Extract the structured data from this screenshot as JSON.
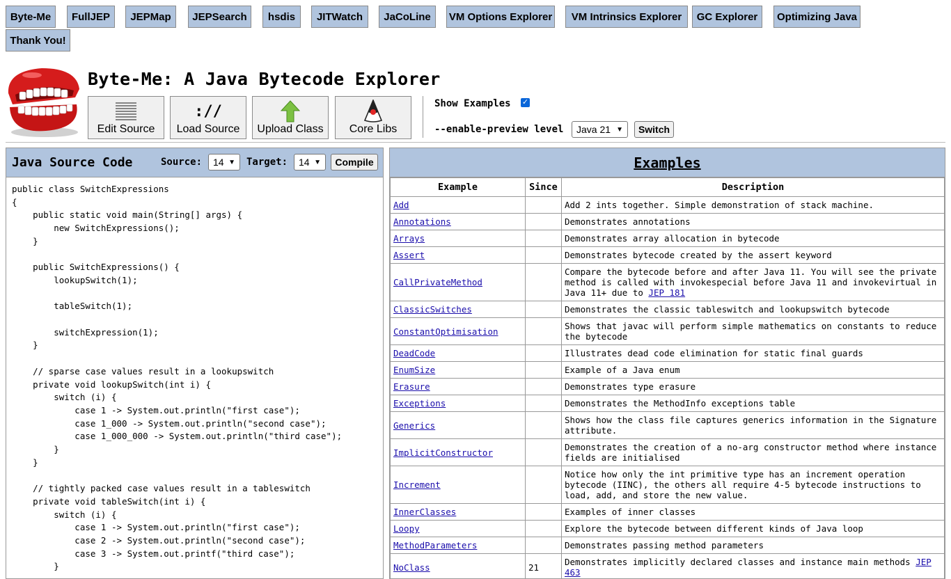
{
  "nav": [
    "Byte-Me",
    "FullJEP",
    "JEPMap",
    "JEPSearch",
    "hsdis",
    "JITWatch",
    "JaCoLine",
    "VM Options Explorer",
    "VM Intrinsics Explorer",
    "GC Explorer",
    "Optimizing Java",
    "Thank You!"
  ],
  "app_title": "Byte-Me: A Java Bytecode Explorer",
  "toolbar": {
    "edit_source": "Edit Source",
    "load_source": "Load Source",
    "load_source_icon": "://",
    "upload_class": "Upload Class",
    "core_libs": "Core Libs"
  },
  "options": {
    "show_examples_label": "Show Examples",
    "show_examples_checked": true,
    "preview_label": "--enable-preview level",
    "preview_value": "Java 21",
    "switch_label": "Switch"
  },
  "left": {
    "title": "Java Source Code",
    "source_label": "Source:",
    "source_value": "14",
    "target_label": "Target:",
    "target_value": "14",
    "compile_label": "Compile",
    "code": "public class SwitchExpressions\n{\n    public static void main(String[] args) {\n        new SwitchExpressions();\n    }\n\n    public SwitchExpressions() {\n        lookupSwitch(1);\n\n        tableSwitch(1);\n\n        switchExpression(1);\n    }\n\n    // sparse case values result in a lookupswitch\n    private void lookupSwitch(int i) {\n        switch (i) {\n            case 1 -> System.out.println(\"first case\");\n            case 1_000 -> System.out.println(\"second case\");\n            case 1_000_000 -> System.out.println(\"third case\");\n        }\n    }\n\n    // tightly packed case values result in a tableswitch\n    private void tableSwitch(int i) {\n        switch (i) {\n            case 1 -> System.out.println(\"first case\");\n            case 2 -> System.out.println(\"second case\");\n            case 3 -> System.out.printf(\"third case\");\n        }"
  },
  "examples": {
    "title": "Examples",
    "headers": [
      "Example",
      "Since",
      "Description"
    ],
    "rows": [
      {
        "name": "Add",
        "since": "",
        "desc": "Add 2 ints together. Simple demonstration of stack machine."
      },
      {
        "name": "Annotations",
        "since": "",
        "desc": "Demonstrates annotations"
      },
      {
        "name": "Arrays",
        "since": "",
        "desc": "Demonstrates array allocation in bytecode"
      },
      {
        "name": "Assert",
        "since": "",
        "desc": "Demonstrates bytecode created by the assert keyword"
      },
      {
        "name": "CallPrivateMethod",
        "since": "",
        "desc": "Compare the bytecode before and after Java 11. You will see the private method is called with invokespecial before Java 11 and invokevirtual in Java 11+ due to",
        "link": "JEP 181"
      },
      {
        "name": "ClassicSwitches",
        "since": "",
        "desc": "Demonstrates the classic tableswitch and lookupswitch bytecode"
      },
      {
        "name": "ConstantOptimisation",
        "since": "",
        "desc": "Shows that javac will perform simple mathematics on constants to reduce the bytecode"
      },
      {
        "name": "DeadCode",
        "since": "",
        "desc": "Illustrates dead code elimination for static final guards"
      },
      {
        "name": "EnumSize",
        "since": "",
        "desc": "Example of a Java enum"
      },
      {
        "name": "Erasure",
        "since": "",
        "desc": "Demonstrates type erasure"
      },
      {
        "name": "Exceptions",
        "since": "",
        "desc": "Demonstrates the MethodInfo exceptions table"
      },
      {
        "name": "Generics",
        "since": "",
        "desc": "Shows how the class file captures generics information in the Signature attribute."
      },
      {
        "name": "ImplicitConstructor",
        "since": "",
        "desc": "Demonstrates the creation of a no-arg constructor method where instance fields are initialised"
      },
      {
        "name": "Increment",
        "since": "",
        "desc": "Notice how only the int primitive type has an increment operation bytecode (IINC), the others all require 4-5 bytecode instructions to load, add, and store the new value."
      },
      {
        "name": "InnerClasses",
        "since": "",
        "desc": "Examples of inner classes"
      },
      {
        "name": "Loopy",
        "since": "",
        "desc": "Explore the bytecode between different kinds of Java loop"
      },
      {
        "name": "MethodParameters",
        "since": "",
        "desc": "Demonstrates passing method parameters"
      },
      {
        "name": "NoClass",
        "since": "21",
        "desc": "Demonstrates implicitly declared classes and instance main methods",
        "link": "JEP 463"
      }
    ]
  }
}
